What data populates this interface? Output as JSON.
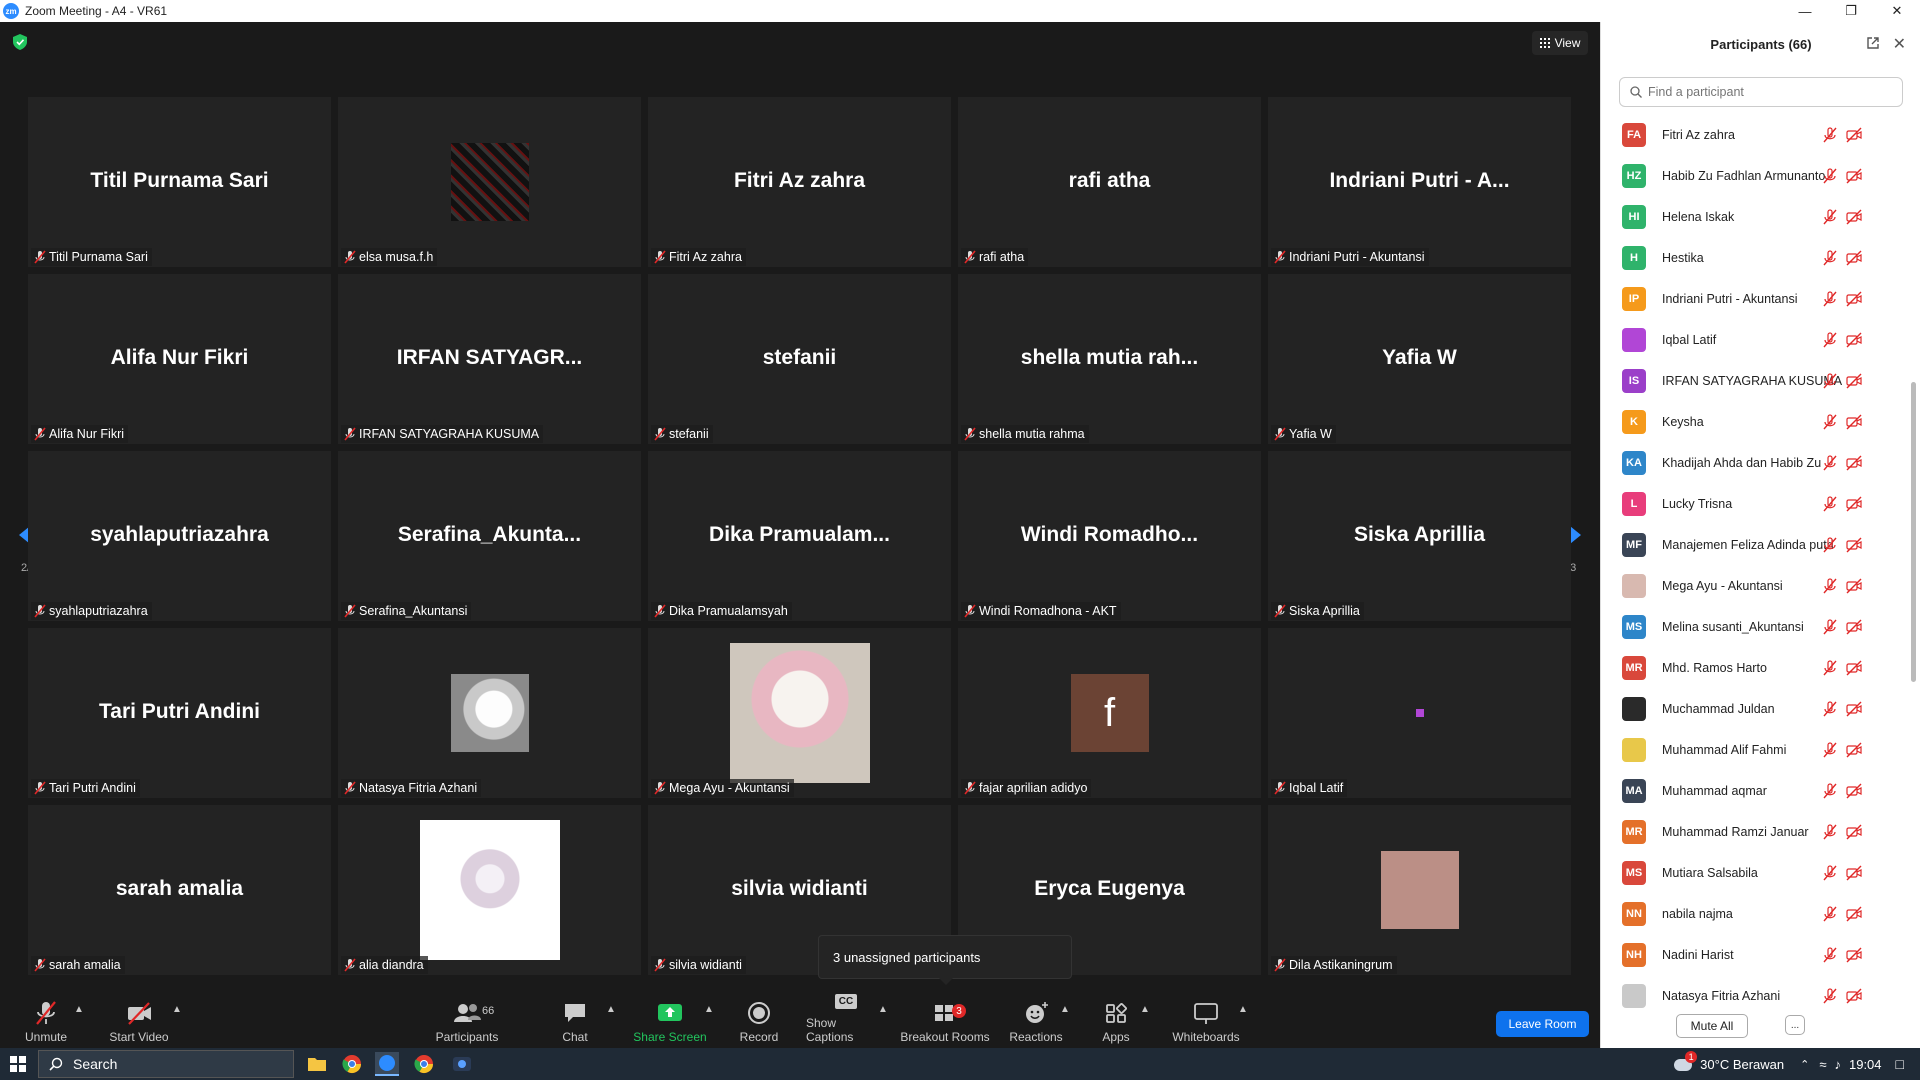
{
  "window": {
    "title": "Zoom Meeting - A4 - VR61",
    "logo": "zm"
  },
  "view_button": {
    "label": "View"
  },
  "gallery": {
    "page_label_left": "2/3",
    "page_label_right": "2/3",
    "tiles": [
      {
        "big": "Titil Purnama Sari",
        "name": "Titil Purnama Sari"
      },
      {
        "big": "",
        "name": "elsa musa.f.h",
        "image": "dark-pattern"
      },
      {
        "big": "Fitri Az zahra",
        "name": "Fitri Az zahra"
      },
      {
        "big": "rafi atha",
        "name": "rafi atha"
      },
      {
        "big": "Indriani Putri - A...",
        "name": "Indriani Putri - Akuntansi"
      },
      {
        "big": "Alifa Nur Fikri",
        "name": "Alifa Nur Fikri"
      },
      {
        "big": "IRFAN  SATYAGR...",
        "name": "IRFAN SATYAGRAHA KUSUMA"
      },
      {
        "big": "stefanii",
        "name": "stefanii"
      },
      {
        "big": "shella  mutia  rah...",
        "name": "shella mutia rahma"
      },
      {
        "big": "Yafia W",
        "name": "Yafia W"
      },
      {
        "big": "syahlaputriazahra",
        "name": "syahlaputriazahra"
      },
      {
        "big": "Serafina_Akunta...",
        "name": "Serafina_Akuntansi"
      },
      {
        "big": "Dika  Pramualam...",
        "name": "Dika Pramualamsyah"
      },
      {
        "big": "Windi  Romadho...",
        "name": "Windi Romadhona - AKT"
      },
      {
        "big": "Siska Aprillia",
        "name": "Siska Aprillia"
      },
      {
        "big": "Tari Putri Andini",
        "name": "Tari Putri Andini"
      },
      {
        "big": "",
        "name": "Natasya Fitria Azhani",
        "image": "cat-grey"
      },
      {
        "big": "",
        "name": "Mega Ayu - Akuntansi",
        "image": "kitten-pink"
      },
      {
        "big": "",
        "name": "fajar aprilian adidyo",
        "image": "letter-f"
      },
      {
        "big": "",
        "name": "Iqbal Latif",
        "image": "purple-dot"
      },
      {
        "big": "sarah amalia",
        "name": "sarah amalia"
      },
      {
        "big": "",
        "name": "alia diandra",
        "image": "pearls"
      },
      {
        "big": "silvia widianti",
        "name": "silvia widianti"
      },
      {
        "big": "Eryca Eugenya",
        "name": "Eryca Eugenya"
      },
      {
        "big": "",
        "name": "Dila Astikaningrum",
        "image": "pink-square"
      }
    ]
  },
  "toast": {
    "text": "3 unassigned participants"
  },
  "toolbar": {
    "unmute": "Unmute",
    "start_video": "Start Video",
    "participants": "Participants",
    "participants_count": "66",
    "chat": "Chat",
    "share_screen": "Share Screen",
    "record": "Record",
    "show_captions": "Show Captions",
    "captions_icon_text": "CC",
    "breakout_rooms": "Breakout Rooms",
    "breakout_badge": "3",
    "reactions": "Reactions",
    "apps": "Apps",
    "whiteboards": "Whiteboards",
    "leave_room": "Leave Room"
  },
  "panel": {
    "title": "Participants (66)",
    "search_placeholder": "Find a participant",
    "mute_all": "Mute All",
    "more": "...",
    "participants": [
      {
        "initials": "FA",
        "name": "Fitri Az zahra",
        "color": "#d9483b"
      },
      {
        "initials": "HZ",
        "name": "Habib Zu Fadhlan Armunanto",
        "color": "#2fb36b"
      },
      {
        "initials": "HI",
        "name": "Helena Iskak",
        "color": "#2fb36b"
      },
      {
        "initials": "H",
        "name": "Hestika",
        "color": "#2fb36b"
      },
      {
        "initials": "IP",
        "name": "Indriani Putri - Akuntansi",
        "color": "#f59a1b"
      },
      {
        "initials": "",
        "name": "Iqbal Latif",
        "color": "#b146d6"
      },
      {
        "initials": "IS",
        "name": "IRFAN SATYAGRAHA KUSUMA",
        "color": "#9b3fc9"
      },
      {
        "initials": "K",
        "name": "Keysha",
        "color": "#f59a1b"
      },
      {
        "initials": "KA",
        "name": "Khadijah Ahda dan Habib Zu",
        "color": "#2e86c9"
      },
      {
        "initials": "L",
        "name": "Lucky Trisna",
        "color": "#e83d7b"
      },
      {
        "initials": "MF",
        "name": "Manajemen Feliza Adinda putri",
        "color": "#3a4556"
      },
      {
        "initials": "",
        "name": "Mega Ayu - Akuntansi",
        "color": "#d8b9b0"
      },
      {
        "initials": "MS",
        "name": "Melina susanti_Akuntansi",
        "color": "#2e86c9"
      },
      {
        "initials": "MR",
        "name": "Mhd. Ramos Harto",
        "color": "#d9483b"
      },
      {
        "initials": "",
        "name": "Muchammad Juldan",
        "color": "#2a2a2a"
      },
      {
        "initials": "",
        "name": "Muhammad Alif Fahmi",
        "color": "#e8c84a"
      },
      {
        "initials": "MA",
        "name": "Muhammad aqmar",
        "color": "#3a4556"
      },
      {
        "initials": "MR",
        "name": "Muhammad Ramzi Januar",
        "color": "#e4702a"
      },
      {
        "initials": "MS",
        "name": "Mutiara Salsabila",
        "color": "#d9483b"
      },
      {
        "initials": "NN",
        "name": "nabila najma",
        "color": "#e4702a"
      },
      {
        "initials": "NH",
        "name": "Nadini Harist",
        "color": "#e4702a"
      },
      {
        "initials": "",
        "name": "Natasya Fitria Azhani",
        "color": "#c9c9c9"
      }
    ]
  },
  "taskbar": {
    "search_label": "Search",
    "weather": "30°C  Berawan",
    "time": "19:04",
    "weather_badge": "1"
  }
}
